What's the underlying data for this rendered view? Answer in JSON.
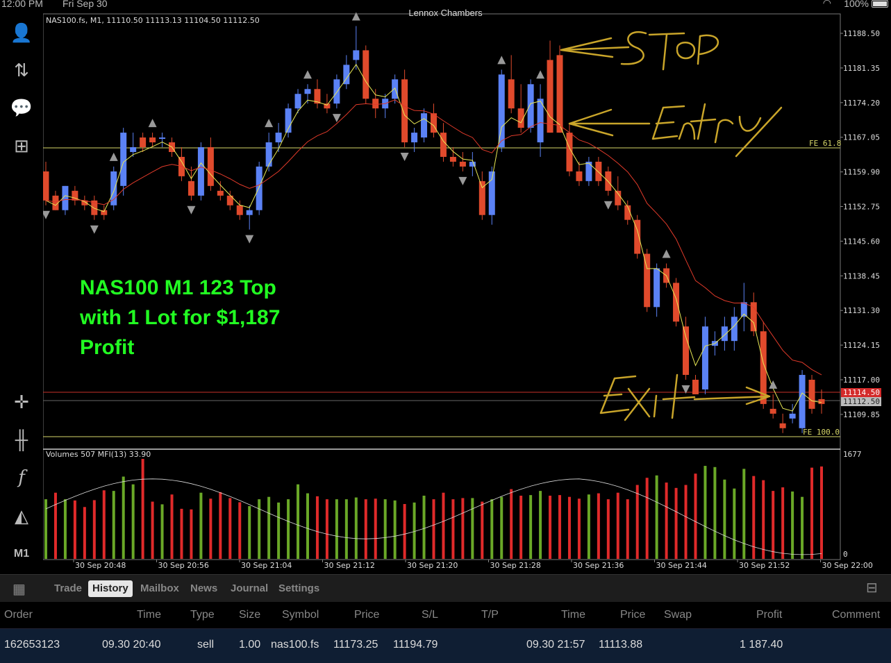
{
  "status_bar": {
    "time": "12:00 PM",
    "date": "Fri Sep 30",
    "battery": "100%"
  },
  "window_title": "Lennox Chambers",
  "sidebar": {
    "items": [
      {
        "name": "account-icon"
      },
      {
        "name": "trade-arrows-icon"
      },
      {
        "name": "chat-icon"
      },
      {
        "name": "new-document-icon"
      },
      {
        "name": "crosshair-icon"
      },
      {
        "name": "candlestick-icon"
      },
      {
        "name": "indicator-icon"
      },
      {
        "name": "objects-icon"
      }
    ],
    "timeframe": "M1"
  },
  "chart": {
    "info": "NAS100.fs, M1, 11110.50 11113.13 11104.50 11112.50",
    "volume_info": "Volumes 507 MFI(13) 33.90",
    "price_axis": [
      "11188.50",
      "11181.35",
      "11174.20",
      "11167.05",
      "11159.90",
      "11152.75",
      "11145.60",
      "11138.45",
      "11131.30",
      "11124.15",
      "11117.00",
      "11109.85"
    ],
    "time_axis": [
      "30 Sep 20:48",
      "30 Sep 20:56",
      "30 Sep 21:04",
      "30 Sep 21:12",
      "30 Sep 21:20",
      "30 Sep 21:28",
      "30 Sep 21:36",
      "30 Sep 21:44",
      "30 Sep 21:52",
      "30 Sep 22:00"
    ],
    "bid_label": "11114.50",
    "ask_label": "11112.50",
    "fe_top": "FE 61.8",
    "fe_bottom": "FE 100.0",
    "vol_max": "1677",
    "vol_min": "0",
    "colors": {
      "bull": "#5b82f5",
      "bear": "#e04a2c",
      "ema_fast": "#e8e855",
      "ema_slow": "#e03a2a",
      "vol_up": "#6aa827",
      "vol_down": "#e02a2a"
    },
    "handwriting": {
      "stop": "Stop",
      "entry": "Entry",
      "exit": "Exit"
    }
  },
  "annotation": {
    "line1": "NAS100 M1 123 Top",
    "line2": "with 1 Lot for $1,187",
    "line3": "Profit"
  },
  "tabs": {
    "trade": "Trade",
    "history": "History",
    "mailbox": "Mailbox",
    "news": "News",
    "journal": "Journal",
    "settings": "Settings"
  },
  "history_header": {
    "order": "Order",
    "time": "Time",
    "type": "Type",
    "size": "Size",
    "symbol": "Symbol",
    "price": "Price",
    "sl": "S/L",
    "tp": "T/P",
    "time2": "Time",
    "price2": "Price",
    "swap": "Swap",
    "profit": "Profit",
    "comment": "Comment"
  },
  "history_row": {
    "order": "162653123",
    "open_time": "09.30 20:40",
    "type": "sell",
    "size": "1.00",
    "symbol": "nas100.fs",
    "open_price": "11173.25",
    "sl": "11194.79",
    "tp": "",
    "close_time": "09.30 21:57",
    "close_price": "11113.88",
    "swap": "",
    "profit": "1 187.40",
    "comment": ""
  }
}
